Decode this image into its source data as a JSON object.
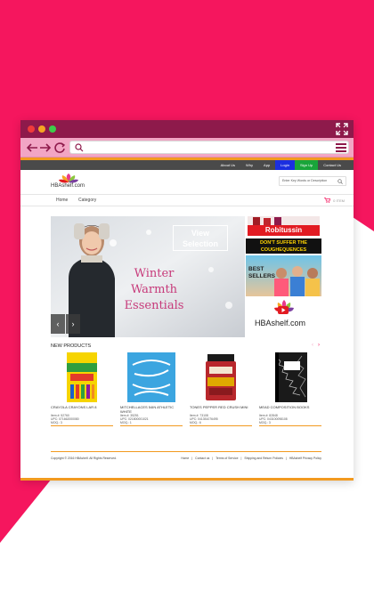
{
  "browser": {
    "address": ""
  },
  "site": {
    "top_links": [
      "About Us",
      "Why",
      "App",
      "Login",
      "Sign Up",
      "Contact Us"
    ],
    "logo_text": "HBAshelf.com",
    "search_placeholder": "Enter Key Words or Description",
    "menu": [
      "Home",
      "Category"
    ],
    "cart_text": "0 ITEM"
  },
  "banner": {
    "view_selection": "View\nSelection",
    "headline_lines": [
      "Winter",
      "Warmth",
      "Essentials"
    ],
    "side": {
      "robitussin": "Robitussin",
      "tagline_lines": [
        "DON'T SUFFER THE",
        "COUGHEQUENCES"
      ],
      "best_sellers_lines": [
        "BEST",
        "SELLERS"
      ],
      "logo_text": "HBAshelf.com"
    }
  },
  "new_products": {
    "title": "NEW PRODUCTS",
    "items": [
      {
        "name": "CRAYOLA CRAYONS LAR 8",
        "item": "Item #: 52760",
        "upc": "UPC: 071662000080",
        "moq": "MOQ.: 3"
      },
      {
        "name": "MITCHELLACES 54IN ATHLETIC WHITE",
        "item": "Item #: 35251",
        "upc": "UPC: 021800001021",
        "moq": "MOQ.: 1"
      },
      {
        "name": "TONES PEPPER RED CRUSH MINI",
        "item": "Item #: 73108",
        "upc": "UPC: 041351076495",
        "moq": "MOQ.: 6"
      },
      {
        "name": "MEAD COMPOSITION BOOKS",
        "item": "Item #: 82848",
        "upc": "UPC: 043100098108",
        "moq": "MOQ.: 3"
      }
    ]
  },
  "footer": {
    "copyright": "Copyright © 2016 HBAshelf. All Rights Reserved.",
    "links": [
      "Home",
      "|",
      "Contact us",
      "|",
      "Terms of Service",
      "|",
      "Shipping and Return Policies",
      "|",
      "HBAshelf Privacy Policy"
    ]
  }
}
